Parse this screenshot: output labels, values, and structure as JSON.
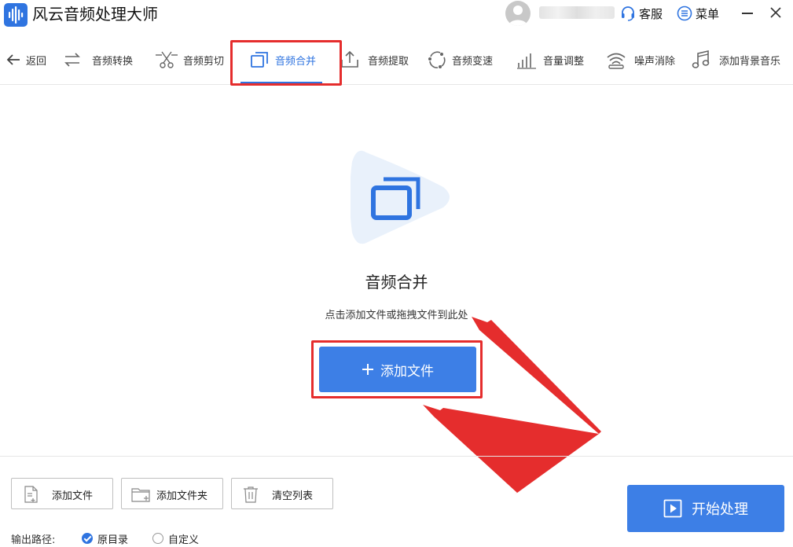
{
  "app": {
    "title": "风云音频处理大师"
  },
  "header": {
    "service_label": "客服",
    "menu_label": "菜单"
  },
  "toolbar": {
    "back_label": "返回",
    "tools": [
      {
        "label": "音频转换"
      },
      {
        "label": "音频剪切"
      },
      {
        "label": "音频合并"
      },
      {
        "label": "音频提取"
      },
      {
        "label": "音频变速"
      },
      {
        "label": "音量调整"
      },
      {
        "label": "噪声消除"
      },
      {
        "label": "添加背景音乐"
      }
    ],
    "active_tool": "音频合并"
  },
  "dropzone": {
    "title": "音频合并",
    "hint": "点击添加文件或拖拽文件到此处",
    "add_button_label": "添加文件"
  },
  "bottom": {
    "add_file_label": "添加文件",
    "add_folder_label": "添加文件夹",
    "clear_list_label": "清空列表",
    "output_path_label": "输出路径:",
    "output_options": [
      {
        "label": "原目录",
        "checked": true
      },
      {
        "label": "自定义",
        "checked": false
      }
    ],
    "start_label": "开始处理"
  },
  "colors": {
    "accent": "#2f74e0",
    "button_blue": "#3d7fe6",
    "annotation_red": "#e52d2d"
  }
}
